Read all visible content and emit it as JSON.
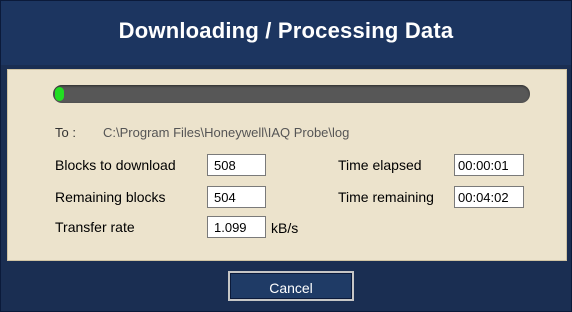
{
  "window": {
    "title": "Downloading / Processing Data"
  },
  "progress": {
    "fraction": 0.02
  },
  "destination": {
    "label": "To :",
    "path": "C:\\Program Files\\Honeywell\\IAQ Probe\\log"
  },
  "stats": {
    "blocks_to_download": {
      "label": "Blocks to download",
      "value": "508"
    },
    "remaining_blocks": {
      "label": "Remaining blocks",
      "value": "504"
    },
    "transfer_rate": {
      "label": "Transfer rate",
      "value": "1.099",
      "unit": "kB/s"
    },
    "time_elapsed": {
      "label": "Time elapsed",
      "value": "00:00:01"
    },
    "time_remaining": {
      "label": "Time remaining",
      "value": "00:04:02"
    }
  },
  "buttons": {
    "cancel": "Cancel"
  },
  "colors": {
    "header_bg": "#1c3560",
    "panel_bg": "#ece3cc",
    "progress_fill": "#22dd22",
    "progress_track": "#575757"
  }
}
